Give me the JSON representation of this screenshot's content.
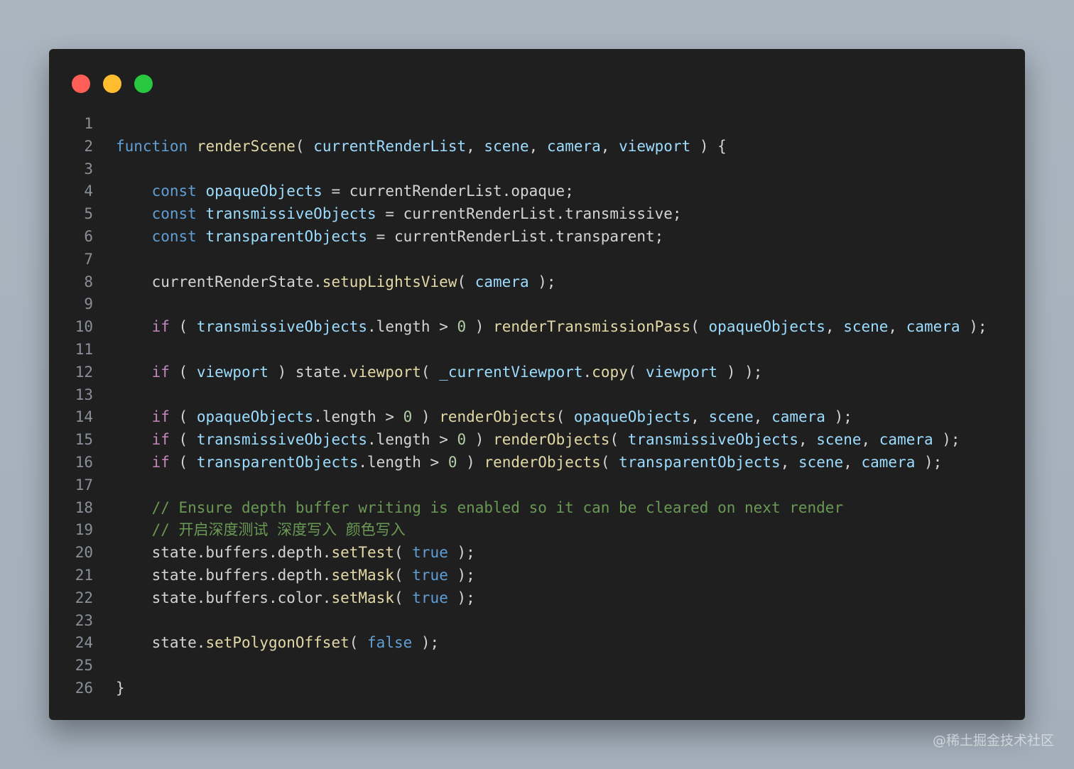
{
  "window": {
    "traffic_lights": [
      {
        "name": "close",
        "color": "#ff5f57"
      },
      {
        "name": "minimize",
        "color": "#febc2e"
      },
      {
        "name": "zoom",
        "color": "#28c840"
      }
    ]
  },
  "code": {
    "lines": [
      {
        "n": "1",
        "tokens": []
      },
      {
        "n": "2",
        "tokens": [
          [
            "kw",
            "function"
          ],
          [
            "p",
            " "
          ],
          [
            "fn",
            "renderScene"
          ],
          [
            "p",
            "( "
          ],
          [
            "var",
            "currentRenderList"
          ],
          [
            "p",
            ", "
          ],
          [
            "var",
            "scene"
          ],
          [
            "p",
            ", "
          ],
          [
            "var",
            "camera"
          ],
          [
            "p",
            ", "
          ],
          [
            "var",
            "viewport"
          ],
          [
            "p",
            " ) {"
          ]
        ]
      },
      {
        "n": "3",
        "tokens": []
      },
      {
        "n": "4",
        "tokens": [
          [
            "p",
            "    "
          ],
          [
            "kw",
            "const"
          ],
          [
            "p",
            " "
          ],
          [
            "var",
            "opaqueObjects"
          ],
          [
            "p",
            " = "
          ],
          [
            "mem",
            "currentRenderList.opaque"
          ],
          [
            "p",
            ";"
          ]
        ]
      },
      {
        "n": "5",
        "tokens": [
          [
            "p",
            "    "
          ],
          [
            "kw",
            "const"
          ],
          [
            "p",
            " "
          ],
          [
            "var",
            "transmissiveObjects"
          ],
          [
            "p",
            " = "
          ],
          [
            "mem",
            "currentRenderList.transmissive"
          ],
          [
            "p",
            ";"
          ]
        ]
      },
      {
        "n": "6",
        "tokens": [
          [
            "p",
            "    "
          ],
          [
            "kw",
            "const"
          ],
          [
            "p",
            " "
          ],
          [
            "var",
            "transparentObjects"
          ],
          [
            "p",
            " = "
          ],
          [
            "mem",
            "currentRenderList.transparent"
          ],
          [
            "p",
            ";"
          ]
        ]
      },
      {
        "n": "7",
        "tokens": []
      },
      {
        "n": "8",
        "tokens": [
          [
            "p",
            "    "
          ],
          [
            "mem",
            "currentRenderState."
          ],
          [
            "fn",
            "setupLightsView"
          ],
          [
            "p",
            "( "
          ],
          [
            "var",
            "camera"
          ],
          [
            "p",
            " );"
          ]
        ]
      },
      {
        "n": "9",
        "tokens": []
      },
      {
        "n": "10",
        "tokens": [
          [
            "p",
            "    "
          ],
          [
            "kw2",
            "if"
          ],
          [
            "p",
            " ( "
          ],
          [
            "var",
            "transmissiveObjects"
          ],
          [
            "mem",
            ".length"
          ],
          [
            "p",
            " > "
          ],
          [
            "num",
            "0"
          ],
          [
            "p",
            " ) "
          ],
          [
            "fn",
            "renderTransmissionPass"
          ],
          [
            "p",
            "( "
          ],
          [
            "var",
            "opaqueObjects"
          ],
          [
            "p",
            ", "
          ],
          [
            "var",
            "scene"
          ],
          [
            "p",
            ", "
          ],
          [
            "var",
            "camera"
          ],
          [
            "p",
            " );"
          ]
        ]
      },
      {
        "n": "11",
        "tokens": []
      },
      {
        "n": "12",
        "tokens": [
          [
            "p",
            "    "
          ],
          [
            "kw2",
            "if"
          ],
          [
            "p",
            " ( "
          ],
          [
            "var",
            "viewport"
          ],
          [
            "p",
            " ) "
          ],
          [
            "mem",
            "state."
          ],
          [
            "fn",
            "viewport"
          ],
          [
            "p",
            "( "
          ],
          [
            "var",
            "_currentViewport"
          ],
          [
            "mem",
            "."
          ],
          [
            "fn",
            "copy"
          ],
          [
            "p",
            "( "
          ],
          [
            "var",
            "viewport"
          ],
          [
            "p",
            " ) );"
          ]
        ]
      },
      {
        "n": "13",
        "tokens": []
      },
      {
        "n": "14",
        "tokens": [
          [
            "p",
            "    "
          ],
          [
            "kw2",
            "if"
          ],
          [
            "p",
            " ( "
          ],
          [
            "var",
            "opaqueObjects"
          ],
          [
            "mem",
            ".length"
          ],
          [
            "p",
            " > "
          ],
          [
            "num",
            "0"
          ],
          [
            "p",
            " ) "
          ],
          [
            "fn",
            "renderObjects"
          ],
          [
            "p",
            "( "
          ],
          [
            "var",
            "opaqueObjects"
          ],
          [
            "p",
            ", "
          ],
          [
            "var",
            "scene"
          ],
          [
            "p",
            ", "
          ],
          [
            "var",
            "camera"
          ],
          [
            "p",
            " );"
          ]
        ]
      },
      {
        "n": "15",
        "tokens": [
          [
            "p",
            "    "
          ],
          [
            "kw2",
            "if"
          ],
          [
            "p",
            " ( "
          ],
          [
            "var",
            "transmissiveObjects"
          ],
          [
            "mem",
            ".length"
          ],
          [
            "p",
            " > "
          ],
          [
            "num",
            "0"
          ],
          [
            "p",
            " ) "
          ],
          [
            "fn",
            "renderObjects"
          ],
          [
            "p",
            "( "
          ],
          [
            "var",
            "transmissiveObjects"
          ],
          [
            "p",
            ", "
          ],
          [
            "var",
            "scene"
          ],
          [
            "p",
            ", "
          ],
          [
            "var",
            "camera"
          ],
          [
            "p",
            " );"
          ]
        ]
      },
      {
        "n": "16",
        "tokens": [
          [
            "p",
            "    "
          ],
          [
            "kw2",
            "if"
          ],
          [
            "p",
            " ( "
          ],
          [
            "var",
            "transparentObjects"
          ],
          [
            "mem",
            ".length"
          ],
          [
            "p",
            " > "
          ],
          [
            "num",
            "0"
          ],
          [
            "p",
            " ) "
          ],
          [
            "fn",
            "renderObjects"
          ],
          [
            "p",
            "( "
          ],
          [
            "var",
            "transparentObjects"
          ],
          [
            "p",
            ", "
          ],
          [
            "var",
            "scene"
          ],
          [
            "p",
            ", "
          ],
          [
            "var",
            "camera"
          ],
          [
            "p",
            " );"
          ]
        ]
      },
      {
        "n": "17",
        "tokens": []
      },
      {
        "n": "18",
        "tokens": [
          [
            "p",
            "    "
          ],
          [
            "cm",
            "// Ensure depth buffer writing is enabled so it can be cleared on next render"
          ]
        ]
      },
      {
        "n": "19",
        "tokens": [
          [
            "p",
            "    "
          ],
          [
            "cm",
            "// 开启深度测试 深度写入 颜色写入"
          ]
        ]
      },
      {
        "n": "20",
        "tokens": [
          [
            "p",
            "    "
          ],
          [
            "mem",
            "state.buffers.depth."
          ],
          [
            "fn",
            "setTest"
          ],
          [
            "p",
            "( "
          ],
          [
            "kw",
            "true"
          ],
          [
            "p",
            " );"
          ]
        ]
      },
      {
        "n": "21",
        "tokens": [
          [
            "p",
            "    "
          ],
          [
            "mem",
            "state.buffers.depth."
          ],
          [
            "fn",
            "setMask"
          ],
          [
            "p",
            "( "
          ],
          [
            "kw",
            "true"
          ],
          [
            "p",
            " );"
          ]
        ]
      },
      {
        "n": "22",
        "tokens": [
          [
            "p",
            "    "
          ],
          [
            "mem",
            "state.buffers.color."
          ],
          [
            "fn",
            "setMask"
          ],
          [
            "p",
            "( "
          ],
          [
            "kw",
            "true"
          ],
          [
            "p",
            " );"
          ]
        ]
      },
      {
        "n": "23",
        "tokens": []
      },
      {
        "n": "24",
        "tokens": [
          [
            "p",
            "    "
          ],
          [
            "mem",
            "state."
          ],
          [
            "fn",
            "setPolygonOffset"
          ],
          [
            "p",
            "( "
          ],
          [
            "kw",
            "false"
          ],
          [
            "p",
            " );"
          ]
        ]
      },
      {
        "n": "25",
        "tokens": []
      },
      {
        "n": "26",
        "tokens": [
          [
            "p",
            "}"
          ]
        ]
      }
    ]
  },
  "watermark": "@稀土掘金技术社区",
  "colors": {
    "keyword": "#5f9fd6",
    "control": "#c586c0",
    "function": "#e2d9a6",
    "variable": "#9cdcfe",
    "comment": "#6a9955",
    "number": "#b5cea8"
  }
}
